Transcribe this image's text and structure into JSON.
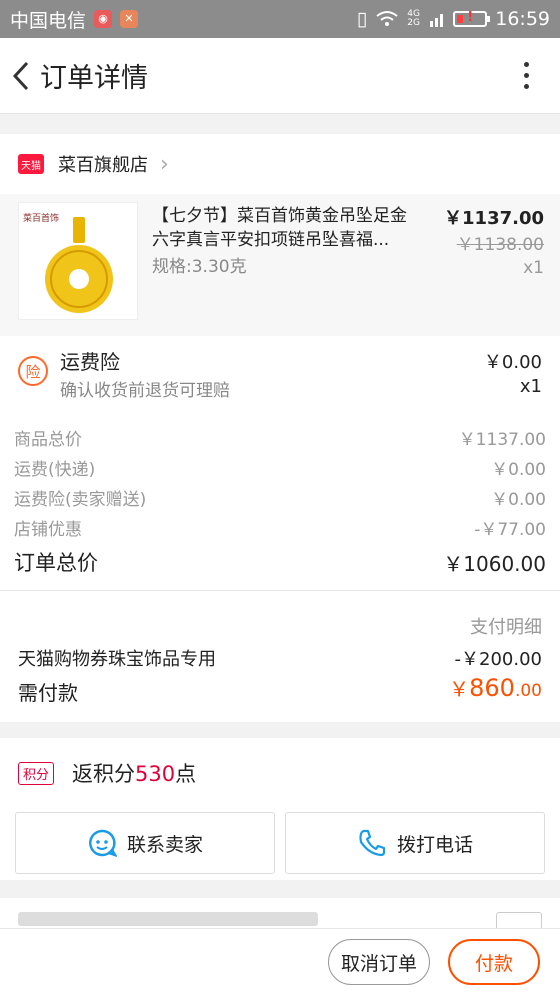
{
  "status_bar": {
    "carrier": "中国电信",
    "network": "4G 2G",
    "time": "16:59"
  },
  "header": {
    "title": "订单详情"
  },
  "store": {
    "badge": "天猫",
    "name": "菜百旗舰店"
  },
  "product": {
    "brand_text": "菜百首饰",
    "title": "【七夕节】菜百首饰黄金吊坠足金六字真言平安扣项链吊坠喜福...",
    "spec": "规格:3.30克",
    "price": "￥1137.00",
    "original_price": "￥1138.00",
    "quantity": "x1"
  },
  "insurance": {
    "icon_text": "险",
    "title": "运费险",
    "subtitle": "确认收货前退货可理赔",
    "price": "￥0.00",
    "quantity": "x1"
  },
  "summary": {
    "rows": [
      {
        "label": "商品总价",
        "value": "￥1137.00"
      },
      {
        "label": "运费(快递)",
        "value": "￥0.00"
      },
      {
        "label": "运费险(卖家赠送)",
        "value": "￥0.00"
      },
      {
        "label": "店铺优惠",
        "value": "-￥77.00"
      }
    ],
    "total_label": "订单总价",
    "total_value": "￥1060.00"
  },
  "payment": {
    "detail_label": "支付明细",
    "coupon_label": "天猫购物券珠宝饰品专用",
    "coupon_value": "-￥200.00",
    "due_label": "需付款",
    "due_symbol": "￥",
    "due_integer": "860",
    "due_decimal": ".00"
  },
  "points": {
    "badge": "积分",
    "prefix": "返积分",
    "amount": "530",
    "suffix": "点"
  },
  "actions": {
    "contact_label": "联系卖家",
    "call_label": "拨打电话"
  },
  "bottom": {
    "cancel_label": "取消订单",
    "pay_label": "付款"
  },
  "colors": {
    "accent": "#ff5000",
    "tmall_red": "#ff1a3d",
    "points_red": "#e0003a",
    "link_blue": "#1a9be8"
  }
}
